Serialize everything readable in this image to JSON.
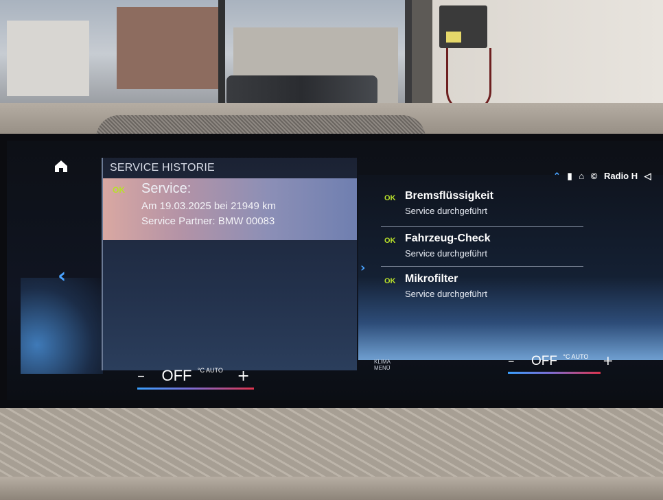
{
  "service_historie": {
    "title": "SERVICE HISTORIE",
    "entry": {
      "status": "OK",
      "title": "Service:",
      "line1": "Am 19.03.2025 bei 21949 km",
      "line2": "Service Partner: BMW 00083"
    }
  },
  "service_items": [
    {
      "status": "OK",
      "title": "Bremsflüssigkeit",
      "subtitle": "Service durchgeführt"
    },
    {
      "status": "OK",
      "title": "Fahrzeug-Check",
      "subtitle": "Service durchgeführt"
    },
    {
      "status": "OK",
      "title": "Mikrofilter",
      "subtitle": "Service durchgeführt"
    }
  ],
  "status_bar": {
    "media": "Radio H"
  },
  "climate": {
    "left": {
      "minus": "–",
      "state": "OFF",
      "unit": "°C AUTO",
      "plus": "+"
    },
    "right": {
      "minus": "–",
      "state": "OFF",
      "unit": "°C AUTO",
      "plus": "+"
    },
    "menu_label_line1": "KLIMA",
    "menu_label_line2": "MENÜ"
  },
  "colors": {
    "ok_green": "#b8e02a",
    "accent_blue": "#4aa3ff",
    "temp_gradient_cold": "#3aa0ff",
    "temp_gradient_hot": "#e0344e"
  },
  "icons": {
    "home": "home-icon",
    "back": "chevron-left-icon",
    "forward": "chevron-right-icon",
    "nav_up": "chevron-up-icon"
  }
}
